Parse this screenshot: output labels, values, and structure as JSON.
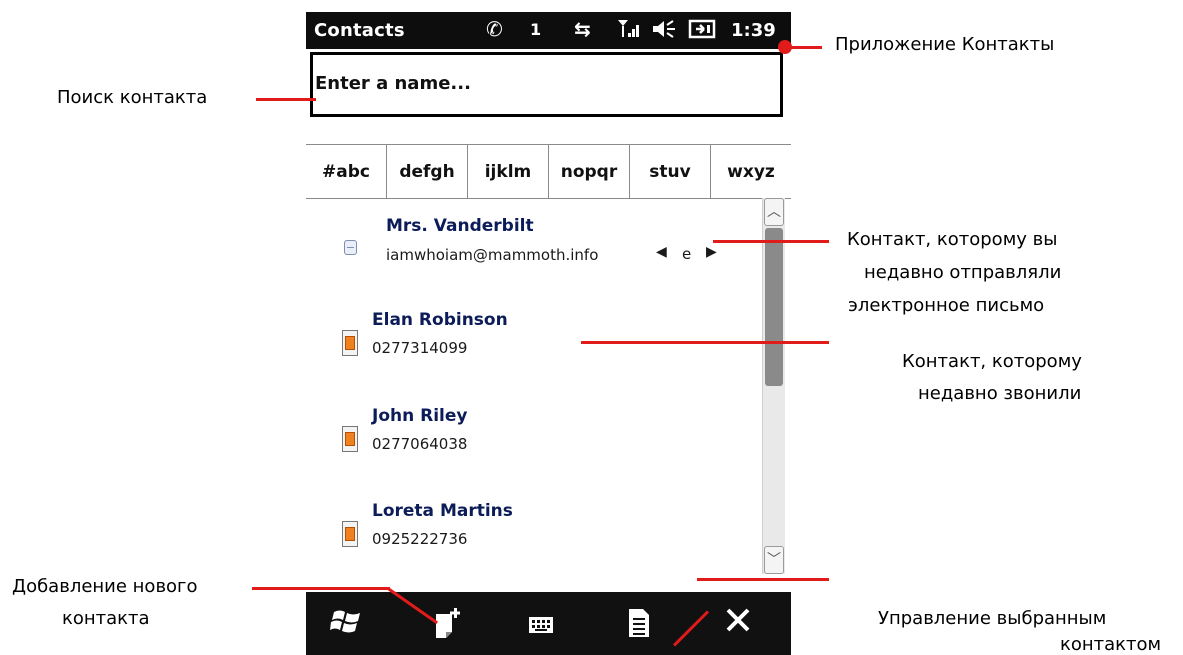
{
  "status_bar": {
    "title": "Contacts",
    "call_icon": "phone-call-icon",
    "call_count": "1",
    "icons": [
      "phone-call-icon",
      "data-sync-icon",
      "signal-icon",
      "volume-icon",
      "battery-charging-icon"
    ],
    "time": "1:39"
  },
  "search": {
    "placeholder": "Enter a name..."
  },
  "alpha_tabs": [
    "#abc",
    "defgh",
    "ijklm",
    "nopqr",
    "stuv",
    "wxyz"
  ],
  "contacts": [
    {
      "name": "Mrs. Vanderbilt",
      "info": "iamwhoiam@mammoth.info",
      "badge": "e",
      "icon": "email-contact-icon"
    },
    {
      "name": "Elan Robinson",
      "info": "0277314099",
      "icon": "contact-card-icon"
    },
    {
      "name": "John Riley",
      "info": "0277064038",
      "icon": "contact-card-icon"
    },
    {
      "name": "Loreta Martins",
      "info": "0925222736",
      "icon": "contact-card-icon"
    }
  ],
  "bottom_bar": {
    "icons": [
      "windows-start-icon",
      "new-contact-icon",
      "keyboard-icon",
      "menu-icon",
      "close-icon"
    ]
  },
  "annotations": {
    "app": "Приложение Контакты",
    "search": "Поиск контакта",
    "emailed_line1": "Контакт, которому вы",
    "emailed_line2": "недавно отправляли",
    "emailed_line3": "электронное письмо",
    "called_line1": "Контакт, которому",
    "called_line2": "недавно звонили",
    "add_line1": "Добавление нового",
    "add_line2": "контакта",
    "manage_line1": "Управление выбранным",
    "manage_line2": "контактом"
  },
  "colors": {
    "accent": "#e11a1a",
    "bar": "#111111",
    "contact_name": "#0c1c58"
  }
}
